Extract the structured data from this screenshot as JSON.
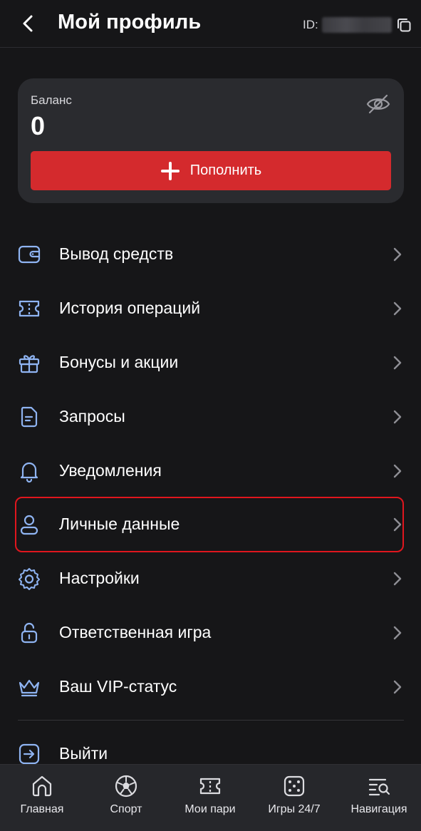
{
  "header": {
    "title": "Мой профиль",
    "id_label": "ID:",
    "back_icon": "chevron-left-icon",
    "copy_icon": "copy-icon"
  },
  "balance": {
    "label": "Баланс",
    "value": "0",
    "hide_icon": "eye-off-icon",
    "topup_label": "Пополнить",
    "topup_color": "#d42a2d"
  },
  "menu": {
    "items": [
      {
        "label": "Вывод средств",
        "icon": "wallet-icon"
      },
      {
        "label": "История операций",
        "icon": "ticket-icon"
      },
      {
        "label": "Бонусы и акции",
        "icon": "gift-icon"
      },
      {
        "label": "Запросы",
        "icon": "document-icon"
      },
      {
        "label": "Уведомления",
        "icon": "bell-icon"
      },
      {
        "label": "Личные данные",
        "icon": "user-icon",
        "highlighted": true
      },
      {
        "label": "Настройки",
        "icon": "gear-icon"
      },
      {
        "label": "Ответственная игра",
        "icon": "lock-icon"
      },
      {
        "label": "Ваш VIP-статус",
        "icon": "crown-icon"
      }
    ],
    "logout_label": "Выйти",
    "logout_icon": "logout-icon",
    "icon_color": "#8fb4f2",
    "highlight_color": "#e0161e"
  },
  "bottom_nav": {
    "items": [
      {
        "label": "Главная",
        "icon": "home-icon"
      },
      {
        "label": "Спорт",
        "icon": "soccer-ball-icon"
      },
      {
        "label": "Мои пари",
        "icon": "ticket-icon"
      },
      {
        "label": "Игры 24/7",
        "icon": "dice-icon"
      },
      {
        "label": "Навигация",
        "icon": "menu-search-icon"
      }
    ]
  }
}
